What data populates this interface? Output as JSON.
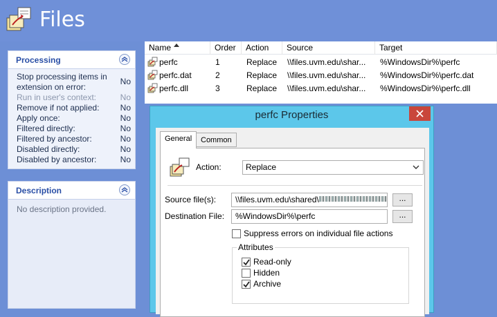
{
  "header": {
    "title": "Files"
  },
  "processing": {
    "title": "Processing",
    "rows": [
      {
        "label": "Stop processing items in extension on error:",
        "value": "No",
        "dim": false
      },
      {
        "label": "Run in user's context:",
        "value": "No",
        "dim": true
      },
      {
        "label": "Remove if not applied:",
        "value": "No",
        "dim": false
      },
      {
        "label": "Apply once:",
        "value": "No",
        "dim": false
      },
      {
        "label": "Filtered directly:",
        "value": "No",
        "dim": false
      },
      {
        "label": "Filtered by ancestor:",
        "value": "No",
        "dim": false
      },
      {
        "label": "Disabled directly:",
        "value": "No",
        "dim": false
      },
      {
        "label": "Disabled by ancestor:",
        "value": "No",
        "dim": false
      }
    ]
  },
  "description": {
    "title": "Description",
    "text": "No description provided."
  },
  "list": {
    "columns": [
      "Name",
      "Order",
      "Action",
      "Source",
      "Target"
    ],
    "rows": [
      {
        "name": "perfc",
        "order": "1",
        "action": "Replace",
        "source": "\\\\files.uvm.edu\\shar...",
        "target": "%WindowsDir%\\perfc"
      },
      {
        "name": "perfc.dat",
        "order": "2",
        "action": "Replace",
        "source": "\\\\files.uvm.edu\\shar...",
        "target": "%WindowsDir%\\perfc.dat"
      },
      {
        "name": "perfc.dll",
        "order": "3",
        "action": "Replace",
        "source": "\\\\files.uvm.edu\\shar...",
        "target": "%WindowsDir%\\perfc.dll"
      }
    ]
  },
  "dialog": {
    "title": "perfc Properties",
    "tabs": [
      "General",
      "Common"
    ],
    "action_label": "Action:",
    "action_value": "Replace",
    "source_label": "Source file(s):",
    "source_value": "\\\\files.uvm.edu\\shared\\",
    "dest_label": "Destination File:",
    "dest_value": "%WindowsDir%\\perfc",
    "browse_label": "...",
    "suppress_label": "Suppress errors on individual file actions",
    "attributes_label": "Attributes",
    "attributes": [
      {
        "label": "Read-only",
        "checked": true
      },
      {
        "label": "Hidden",
        "checked": false
      },
      {
        "label": "Archive",
        "checked": true
      }
    ]
  },
  "colors": {
    "header_bg": "#6f90d8",
    "panel_title": "#2a4fa6",
    "dialog_frame": "#5cc7ea",
    "close_button": "#c9463b"
  }
}
